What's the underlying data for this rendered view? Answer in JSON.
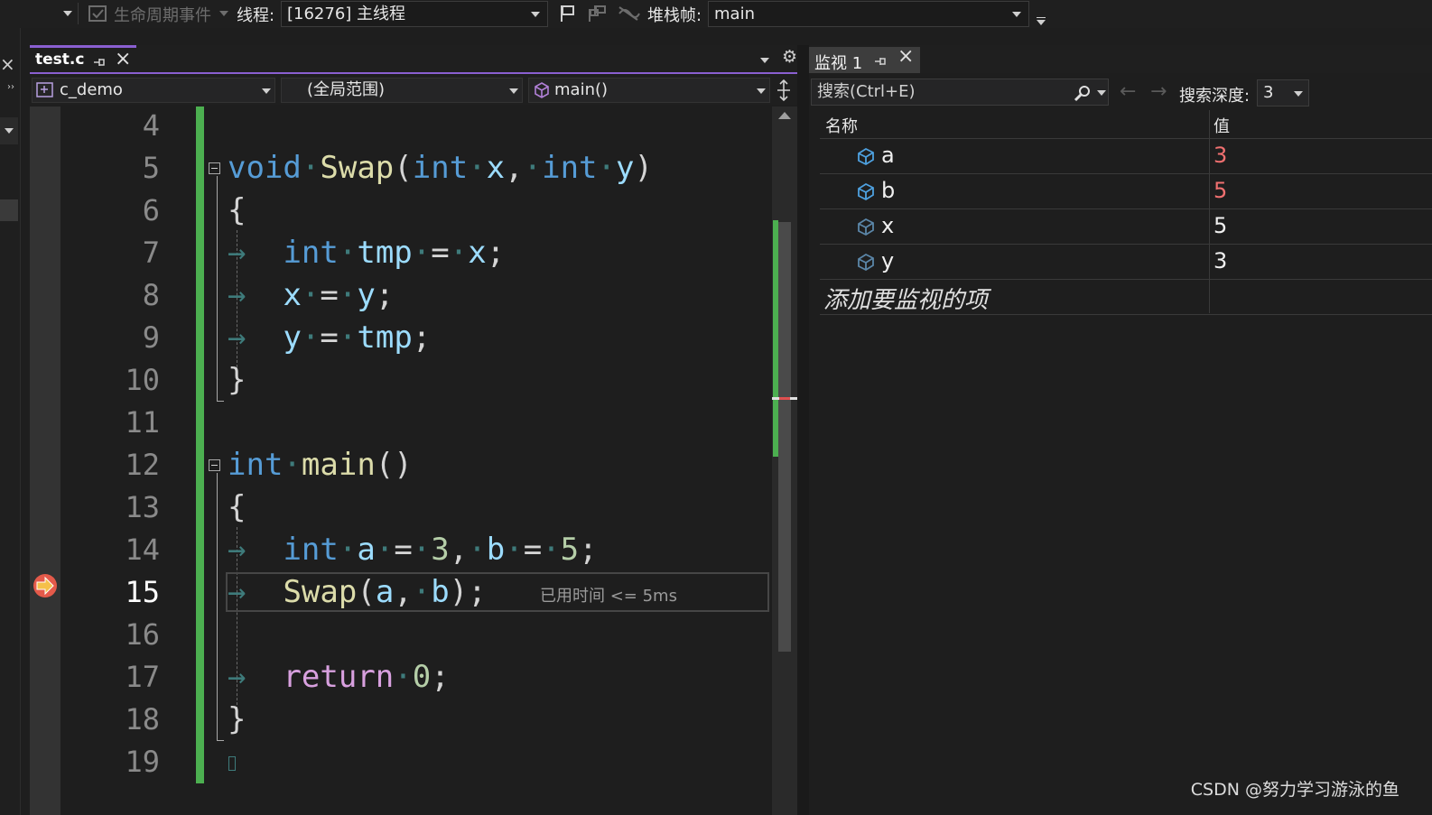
{
  "toolbar": {
    "lifecycle_label": "生命周期事件",
    "thread_label": "线程:",
    "thread_value": "[16276] 主线程",
    "stackframe_label": "堆栈帧:",
    "stackframe_value": "main"
  },
  "editor": {
    "tab_title": "test.c",
    "project_dropdown": "c_demo",
    "scope_dropdown": "(全局范围)",
    "member_dropdown": "main()",
    "current_line": 15,
    "elapsed_hint": "已用时间 <= 5ms",
    "lines": [
      {
        "n": "4"
      },
      {
        "n": "5"
      },
      {
        "n": "6"
      },
      {
        "n": "7"
      },
      {
        "n": "8"
      },
      {
        "n": "9"
      },
      {
        "n": "10"
      },
      {
        "n": "11"
      },
      {
        "n": "12"
      },
      {
        "n": "13"
      },
      {
        "n": "14"
      },
      {
        "n": "15"
      },
      {
        "n": "16"
      },
      {
        "n": "17"
      },
      {
        "n": "18"
      },
      {
        "n": "19"
      }
    ]
  },
  "watch": {
    "tab_title": "监视 1",
    "search_placeholder": "搜索(Ctrl+E)",
    "search_depth_label": "搜索深度:",
    "search_depth_value": "3",
    "col_name": "名称",
    "col_value": "值",
    "rows": [
      {
        "name": "a",
        "value": "3",
        "changed": true
      },
      {
        "name": "b",
        "value": "5",
        "changed": true
      },
      {
        "name": "x",
        "value": "5",
        "changed": false
      },
      {
        "name": "y",
        "value": "3",
        "changed": false
      }
    ],
    "add_item_placeholder": "添加要监视的项",
    "changed_color": "#f07070",
    "normal_color": "#f0f0f0"
  },
  "watermark": "CSDN @努力学习游泳的鱼"
}
